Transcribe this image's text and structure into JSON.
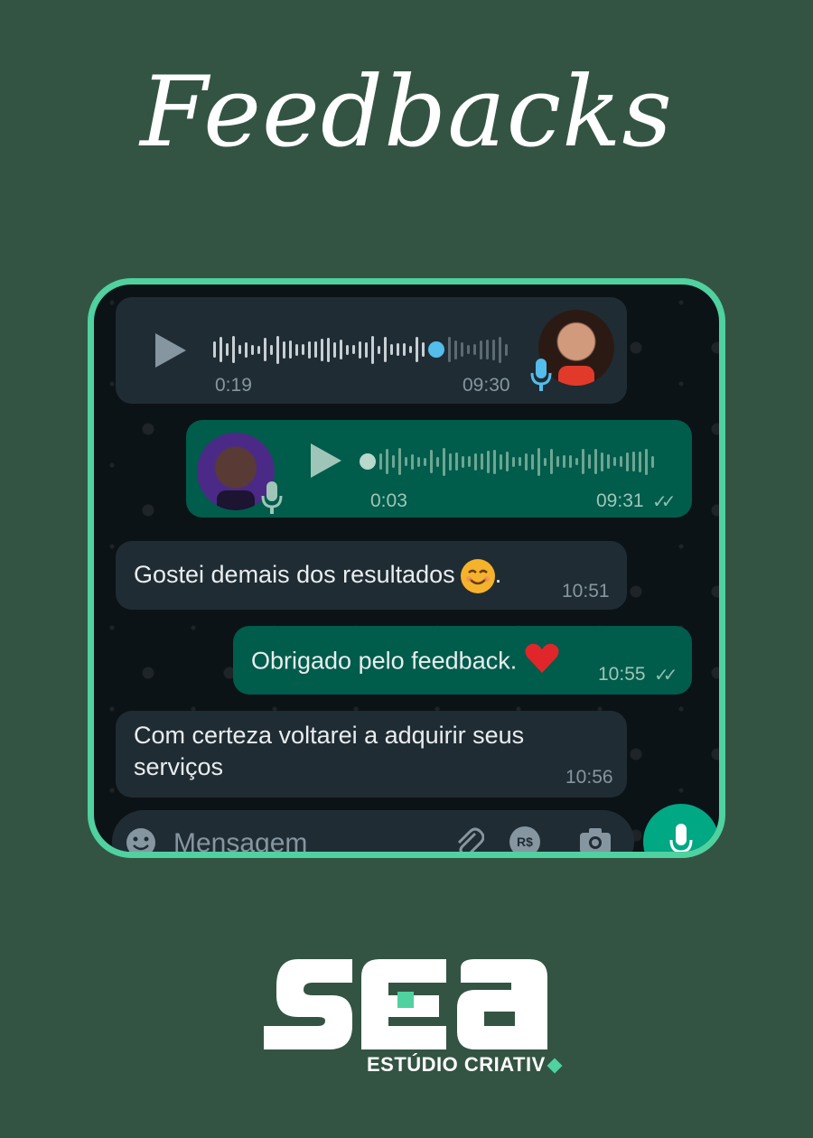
{
  "page": {
    "title": "Feedbacks"
  },
  "chat": {
    "voice_in": {
      "duration": "0:19",
      "time": "09:30",
      "playback_progress": 0.78
    },
    "voice_out": {
      "duration": "0:03",
      "time": "09:31",
      "status": "read",
      "playback_progress": 0.0
    },
    "messages": [
      {
        "direction": "in",
        "text": "Gostei demais dos resultados",
        "emoji": "smiling-face-emoji",
        "suffix": ".",
        "time": "10:51"
      },
      {
        "direction": "out",
        "text": "Obrigado pelo feedback.",
        "emoji": "red-heart-emoji",
        "time": "10:55",
        "status": "read"
      },
      {
        "direction": "in",
        "line1": "Com certeza voltarei a adquirir seus",
        "line2": "serviços",
        "time": "10:56"
      }
    ],
    "input": {
      "placeholder": "Mensagem",
      "currency_label": "R$"
    }
  },
  "brand": {
    "logo_text": "SEA",
    "tagline": "ESTÚDIO CRIATIV"
  },
  "colors": {
    "background": "#345443",
    "frame_border": "#4fd1a0",
    "chat_bg": "#0c1317",
    "bubble_in": "#202c33",
    "bubble_out": "#005c4b",
    "accent": "#00a884",
    "read_blue": "#53bdeb"
  }
}
